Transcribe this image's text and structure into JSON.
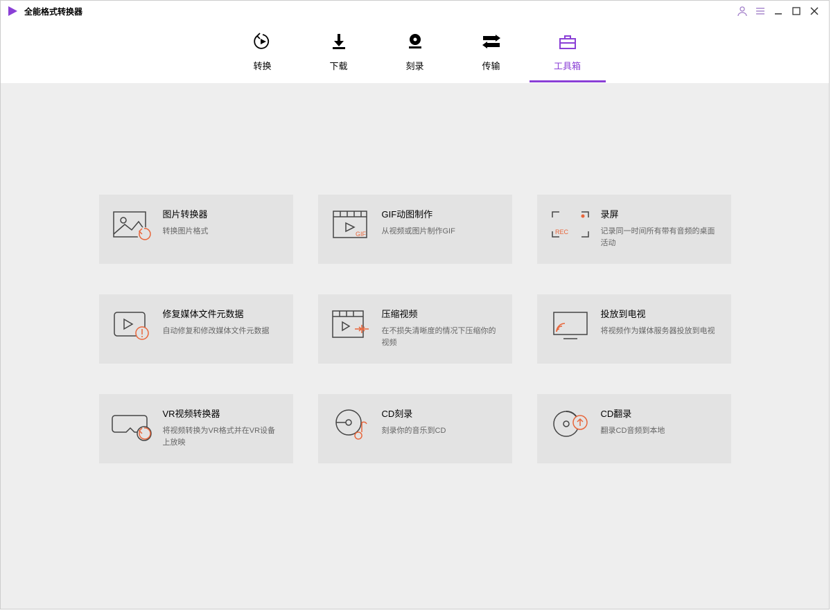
{
  "app": {
    "title": "全能格式转换器"
  },
  "nav": [
    {
      "label": "转换"
    },
    {
      "label": "下载"
    },
    {
      "label": "刻录"
    },
    {
      "label": "传输"
    },
    {
      "label": "工具箱"
    }
  ],
  "tools": [
    {
      "title": "图片转换器",
      "desc": "转换图片格式"
    },
    {
      "title": "GIF动图制作",
      "desc": "从视频或图片制作GIF"
    },
    {
      "title": "录屏",
      "desc": "记录同一时间所有带有音频的桌面活动"
    },
    {
      "title": "修复媒体文件元数据",
      "desc": "自动修复和修改媒体文件元数据"
    },
    {
      "title": "压缩视频",
      "desc": "在不损失清晰度的情况下压缩你的视频"
    },
    {
      "title": "投放到电视",
      "desc": "将视频作为媒体服务器投放到电视"
    },
    {
      "title": "VR视频转换器",
      "desc": "将视频转换为VR格式并在VR设备上放映"
    },
    {
      "title": "CD刻录",
      "desc": "刻录你的音乐到CD"
    },
    {
      "title": "CD翻录",
      "desc": "翻录CD音频到本地"
    }
  ]
}
